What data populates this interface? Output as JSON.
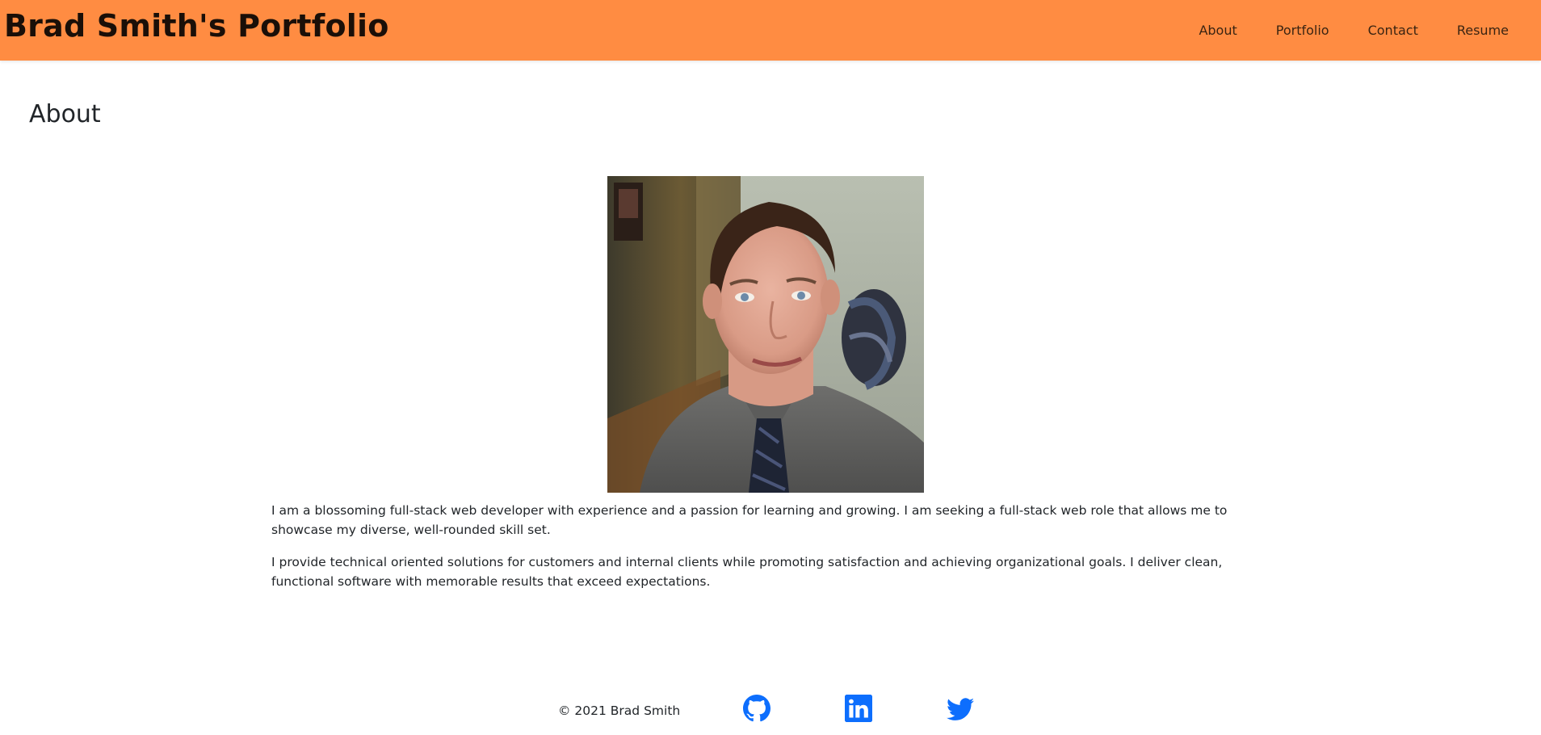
{
  "header": {
    "brand": "Brad Smith's Portfolio",
    "nav": [
      "About",
      "Portfolio",
      "Contact",
      "Resume"
    ]
  },
  "main": {
    "title": "About",
    "photo_alt": "Portrait of Brad Smith",
    "paragraphs": [
      "I am a blossoming full-stack web developer with experience and a passion for learning and growing. I am seeking a full-stack web role that allows me to showcase my diverse, well-rounded skill set.",
      "I provide technical oriented solutions for customers and internal clients while promoting satisfaction and achieving organizational goals. I deliver clean, functional software with memorable results that exceed expectations."
    ]
  },
  "footer": {
    "copyright": "© 2021 Brad Smith",
    "social": [
      {
        "icon": "github-icon"
      },
      {
        "icon": "linkedin-icon"
      },
      {
        "icon": "twitter-icon"
      }
    ]
  },
  "colors": {
    "navbar": "#ff8c42",
    "brand_text": "#1a0f08",
    "social_icons": "#0d6efd"
  }
}
